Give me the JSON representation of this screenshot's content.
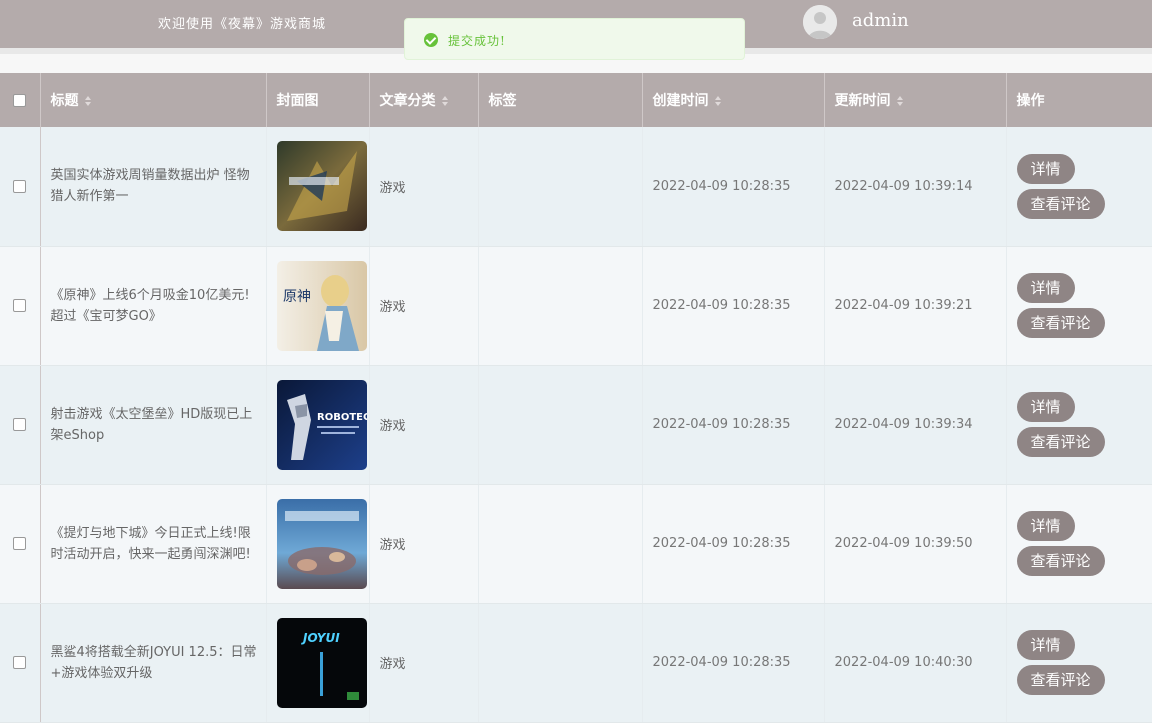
{
  "header": {
    "welcome": "欢迎使用《夜幕》游戏商城",
    "username": "admin"
  },
  "toast": {
    "message": "提交成功!"
  },
  "table": {
    "columns": {
      "title": "标题",
      "cover": "封面图",
      "category": "文章分类",
      "tags": "标签",
      "created": "创建时间",
      "updated": "更新时间",
      "actions": "操作"
    },
    "rows": [
      {
        "title": "英国实体游戏周销量数据出炉 怪物猎人新作第一",
        "category": "游戏",
        "tags": "",
        "created": "2022-04-09 10:28:35",
        "updated": "2022-04-09 10:39:14",
        "detail_label": "详情",
        "comments_label": "查看评论",
        "cover_icon": "monster-hunter-cover"
      },
      {
        "title": "《原神》上线6个月吸金10亿美元!超过《宝可梦GO》",
        "category": "游戏",
        "tags": "",
        "created": "2022-04-09 10:28:35",
        "updated": "2022-04-09 10:39:21",
        "detail_label": "详情",
        "comments_label": "查看评论",
        "cover_icon": "genshin-cover"
      },
      {
        "title": "射击游戏《太空堡垒》HD版现已上架eShop",
        "category": "游戏",
        "tags": "",
        "created": "2022-04-09 10:28:35",
        "updated": "2022-04-09 10:39:34",
        "detail_label": "详情",
        "comments_label": "查看评论",
        "cover_icon": "robotech-cover"
      },
      {
        "title": "《提灯与地下城》今日正式上线!限时活动开启，快来一起勇闯深渊吧!",
        "category": "游戏",
        "tags": "",
        "created": "2022-04-09 10:28:35",
        "updated": "2022-04-09 10:39:50",
        "detail_label": "详情",
        "comments_label": "查看评论",
        "cover_icon": "lantern-dungeon-cover"
      },
      {
        "title": "黑鲨4将搭载全新JOYUI 12.5：日常+游戏体验双升级",
        "category": "游戏",
        "tags": "",
        "created": "2022-04-09 10:28:35",
        "updated": "2022-04-09 10:40:30",
        "detail_label": "详情",
        "comments_label": "查看评论",
        "cover_icon": "joyui-cover"
      }
    ]
  },
  "thumb_texts": {
    "genshin": "原神",
    "robotech": "ROBOTECH",
    "joyui": "JOYUI"
  },
  "colors": {
    "header_bg": "#b4abab",
    "button_bg": "#8f8585",
    "success": "#67c23a",
    "row_odd": "#eaf1f4",
    "row_even": "#f4f7f9"
  }
}
